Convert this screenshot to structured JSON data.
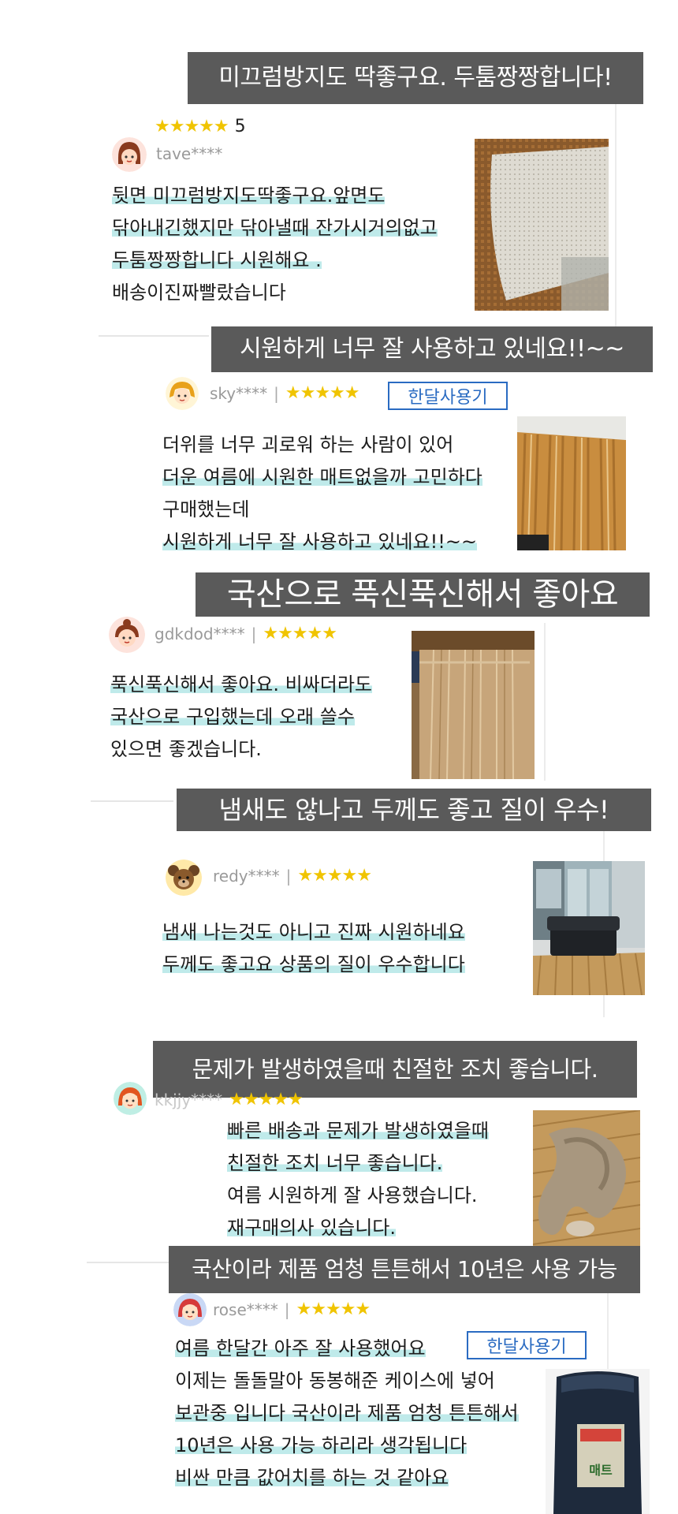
{
  "reviews": [
    {
      "headline": "미끄럼방지도 딱좋구요. 두툼짱짱합니다!",
      "stars": "★★★★★",
      "score": "5",
      "user": "tave****",
      "lines": [
        "뒷면 미끄럼방지도딱좋구요.앞면도",
        "닦아내긴했지만 닦아낼때 잔가시거의없고",
        "두툼짱짱합니다 시원해요 .",
        "배송이진짜빨랐습니다"
      ]
    },
    {
      "headline": "시원하게 너무 잘 사용하고 있네요!!~~",
      "user": "sky****",
      "separator": "|",
      "stars": "★★★★★",
      "badge": "한달사용기",
      "lines": [
        "더위를 너무 괴로워 하는 사람이 있어",
        "더운 여름에 시원한 매트없을까 고민하다",
        "구매했는데",
        "시원하게 너무 잘 사용하고 있네요!!~~"
      ]
    },
    {
      "headline": "국산으로 푹신푹신해서 좋아요",
      "user": "gdkdod****",
      "separator": "|",
      "stars": "★★★★★",
      "lines": [
        "푹신푹신해서 좋아요. 비싸더라도",
        "국산으로 구입했는데 오래 쓸수",
        "있으면 좋겠습니다."
      ]
    },
    {
      "headline": "냄새도 않나고 두께도 좋고 질이 우수!",
      "user": "redy****",
      "separator": "|",
      "stars": "★★★★★",
      "lines": [
        "냄새  나는것도  아니고  진짜  시원하네요",
        "두께도  좋고요  상품의  질이  우수합니다"
      ]
    },
    {
      "headline": "문제가 발생하였을때 친절한 조치 좋습니다.",
      "user": "kkjjy****",
      "stars": "★★★★★",
      "lines": [
        "빠른 배송과 문제가 발생하였을때",
        "친절한 조치 너무 좋습니다.",
        "여름 시원하게 잘 사용했습니다.",
        "재구매의사 있습니다."
      ]
    },
    {
      "headline": "국산이라 제품 엄청 튼튼해서 10년은 사용 가능",
      "user": "rose****",
      "separator": "|",
      "stars": "★★★★★",
      "badge": "한달사용기",
      "lines": [
        "여름 한달간 아주 잘 사용했어요",
        "이제는 돌돌말아 동봉해준 케이스에 넣어",
        "보관중 입니다 국산이라 제품 엄청 튼튼해서",
        "10년은 사용 가능  하리라 생각됩니다",
        "비싼 만큼 값어치를 하는 것 같아요"
      ],
      "package_label": "매트"
    }
  ],
  "colors": {
    "banner": "#5a5a5a",
    "highlight": "#bfeaea",
    "star": "#f0c400",
    "badge": "#2a6bc2"
  }
}
